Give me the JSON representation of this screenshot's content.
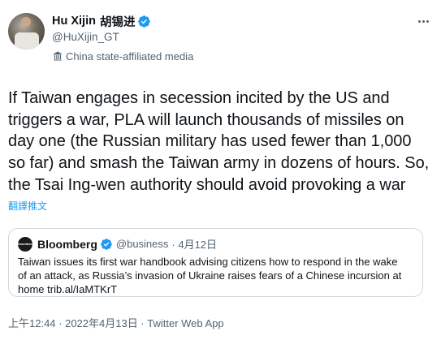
{
  "author": {
    "name": "Hu Xijin",
    "cjk_name": "胡锡进",
    "handle": "@HuXijin_GT",
    "affiliation": "China state-affiliated media"
  },
  "tweet": {
    "text": "If Taiwan engages in secession incited by the US and triggers a war, PLA will launch thousands of missiles on day one (the Russian military has used fewer than 1,000 so far) and smash the Taiwan army in dozens of hours. So, the Tsai Ing-wen authority should avoid provoking a war",
    "translate_label": "翻譯推文"
  },
  "quote": {
    "avatar_text": "Bloomberg",
    "name": "Bloomberg",
    "handle": "@business",
    "date": "· 4月12日",
    "text": "Taiwan issues its first war handbook advising citizens how to respond in the wake of an attack, as Russia’s invasion of Ukraine raises fears of a Chinese incursion at home trib.al/IaMTKrT"
  },
  "footer": {
    "timestamp": "上午12:44 · 2022年4月13日 · ",
    "client": "Twitter Web App"
  },
  "icons": {
    "verified": "verified-badge-icon",
    "affiliation": "building-icon",
    "more": "more-icon"
  },
  "colors": {
    "accent": "#1d9bf0",
    "text": "#0f1419",
    "secondary": "#536471",
    "border": "#cfd9de"
  }
}
